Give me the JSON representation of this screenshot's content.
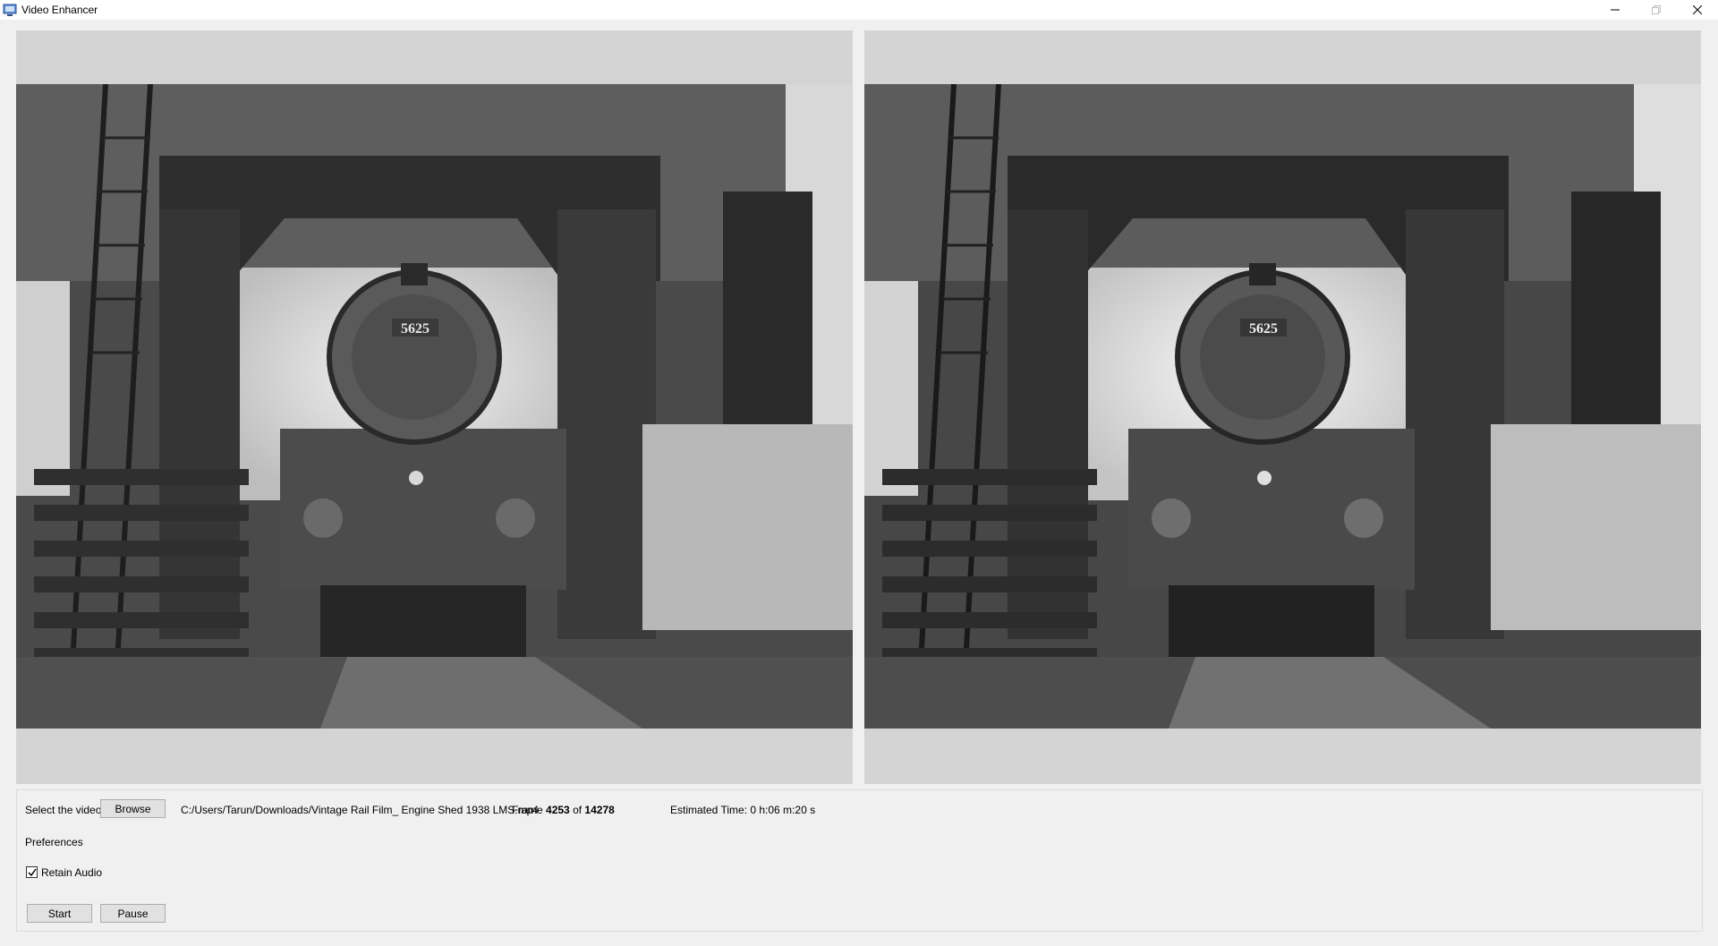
{
  "window": {
    "title": "Video Enhancer"
  },
  "controls": {
    "select_label": "Select the video",
    "browse_label": "Browse",
    "file_path": "C:/Users/Tarun/Downloads/Vintage Rail Film_ Engine Shed 1938 LMS.mp4",
    "frame_prefix": "Frame",
    "frame_current": "4253",
    "frame_of": "of",
    "frame_total": "14278",
    "estimated_time": "Estimated Time: 0 h:06 m:20 s",
    "preferences_label": "Preferences",
    "retain_audio_label": "Retain Audio",
    "retain_audio_checked": true,
    "start_label": "Start",
    "pause_label": "Pause"
  },
  "video": {
    "locomotive_number": "5625"
  },
  "icons": {
    "app": "app-icon",
    "minimize": "minimize-icon",
    "maximize": "maximize-icon",
    "close": "close-icon",
    "check": "check-icon"
  }
}
